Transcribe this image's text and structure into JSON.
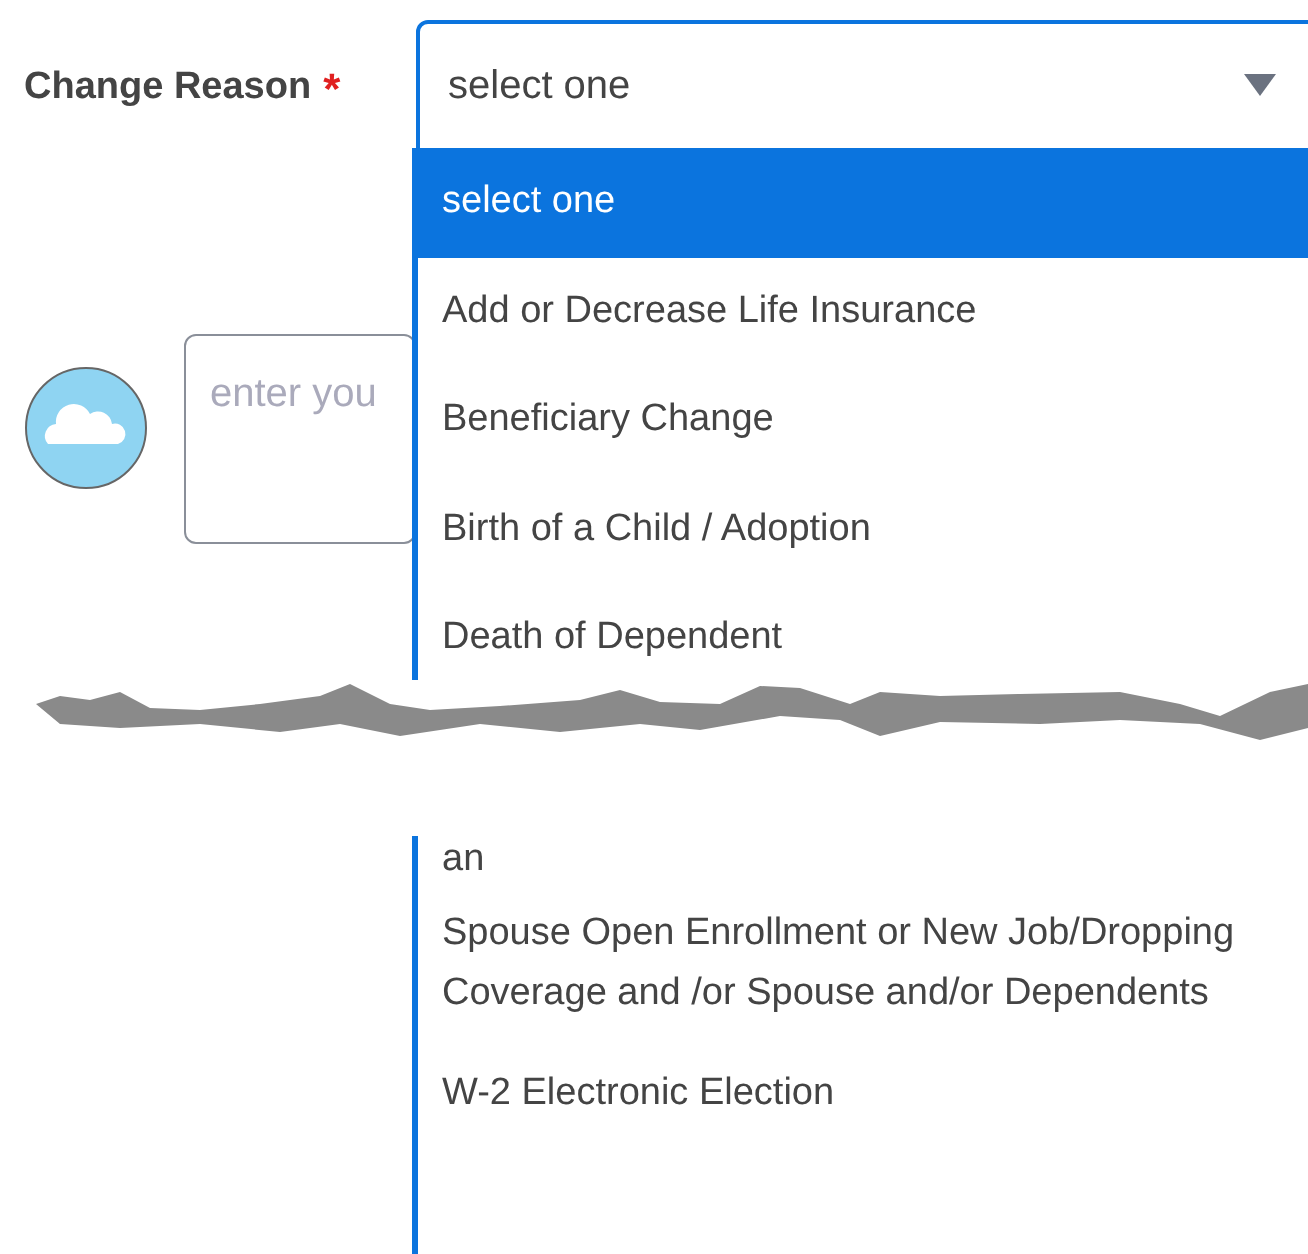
{
  "change_reason": {
    "label": "Change Reason",
    "required_mark": "*",
    "value": "select one",
    "expanded": true,
    "options": [
      {
        "label": "select one",
        "selected": true
      },
      {
        "label": "Add or Decrease Life Insurance",
        "selected": false
      },
      {
        "label": "Beneficiary Change",
        "selected": false
      },
      {
        "label": "Birth of a Child / Adoption",
        "selected": false
      },
      {
        "label": "Death of Dependent",
        "selected": false
      }
    ],
    "options_after_break": [
      {
        "label": "an",
        "selected": false,
        "partial": true
      },
      {
        "label": "Spouse Open Enrollment or New Job/Dropping Coverage and /or Spouse and/or Dependents",
        "selected": false
      },
      {
        "label": "W-2 Electronic Election",
        "selected": false
      }
    ]
  },
  "comment": {
    "placeholder": "enter you"
  }
}
